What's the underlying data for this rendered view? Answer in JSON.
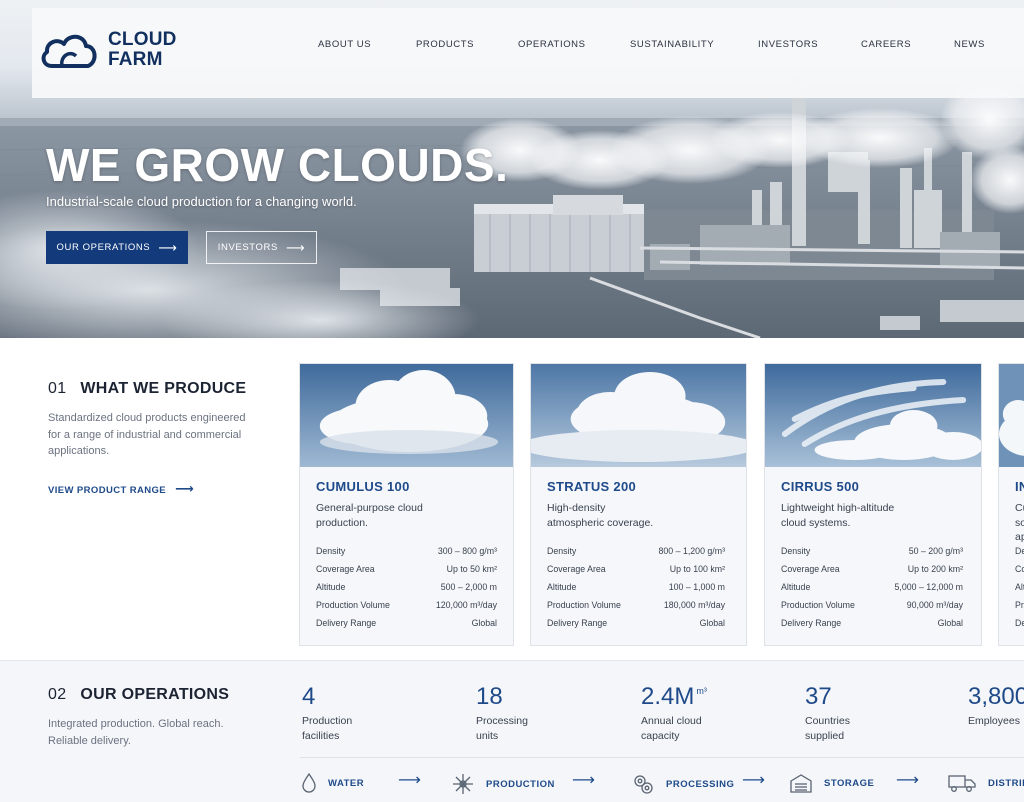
{
  "brand": {
    "name_line1": "CLOUD",
    "name_line2": "FARM",
    "color": "#12305f"
  },
  "nav": {
    "items": [
      "ABOUT US",
      "PRODUCTS",
      "OPERATIONS",
      "SUSTAINABILITY",
      "INVESTORS",
      "CAREERS",
      "NEWS"
    ]
  },
  "hero": {
    "title": "WE GROW CLOUDS.",
    "subtitle": "Industrial-scale cloud production for a changing world.",
    "primary_button": "OUR OPERATIONS",
    "secondary_button": "INVESTORS",
    "arrow_icon": "arrow-right-icon"
  },
  "produce": {
    "number": "01",
    "title": "WHAT WE PRODUCE",
    "description": "Standardized cloud products engineered for a range of industrial and commercial applications.",
    "link": "VIEW PRODUCT RANGE",
    "spec_labels": [
      "Density",
      "Coverage Area",
      "Altitude",
      "Production Volume",
      "Delivery Range"
    ],
    "products": [
      {
        "name": "CUMULUS 100",
        "description": "General-purpose cloud production.",
        "specs": [
          "300 – 800 g/m³",
          "Up to 50 km²",
          "500 – 2,000 m",
          "120,000 m³/day",
          "Global"
        ]
      },
      {
        "name": "STRATUS 200",
        "description": "High-density atmospheric coverage.",
        "specs": [
          "800 – 1,200 g/m³",
          "Up to 100 km²",
          "100 – 1,000 m",
          "180,000 m³/day",
          "Global"
        ]
      },
      {
        "name": "CIRRUS 500",
        "description": "Lightweight high-altitude cloud systems.",
        "specs": [
          "50 – 200 g/m³",
          "Up to 200 km²",
          "5,000 – 12,000 m",
          "90,000 m³/day",
          "Global"
        ]
      },
      {
        "name": "IN",
        "description": "Cu so ap",
        "specs": [
          "",
          "",
          "",
          "",
          ""
        ],
        "spec_label_stubs": [
          "De",
          "Co",
          "Alt",
          "Pr",
          "De"
        ]
      }
    ]
  },
  "operations": {
    "number": "02",
    "title": "OUR OPERATIONS",
    "description": "Integrated production. Global reach. Reliable delivery.",
    "stats": [
      {
        "value": "4",
        "unit": "",
        "label_line1": "Production",
        "label_line2": "facilities"
      },
      {
        "value": "18",
        "unit": "",
        "label_line1": "Processing",
        "label_line2": "units"
      },
      {
        "value": "2.4M",
        "unit": "m³",
        "label_line1": "Annual cloud",
        "label_line2": "capacity"
      },
      {
        "value": "37",
        "unit": "",
        "label_line1": "Countries",
        "label_line2": "supplied"
      },
      {
        "value": "3,800",
        "unit": "",
        "label_line1": "Employees",
        "label_line2": ""
      }
    ],
    "flow": [
      {
        "label": "WATER",
        "icon": "water-drop-icon"
      },
      {
        "label": "PRODUCTION",
        "icon": "snowflake-icon"
      },
      {
        "label": "PROCESSING",
        "icon": "gears-icon"
      },
      {
        "label": "STORAGE",
        "icon": "warehouse-icon"
      },
      {
        "label": "DISTRIB",
        "icon": "truck-icon"
      }
    ]
  },
  "colors": {
    "accent": "#1f4a8a",
    "primary_button": "#133a7a",
    "text": "#1c2433",
    "muted": "#6b7280"
  }
}
